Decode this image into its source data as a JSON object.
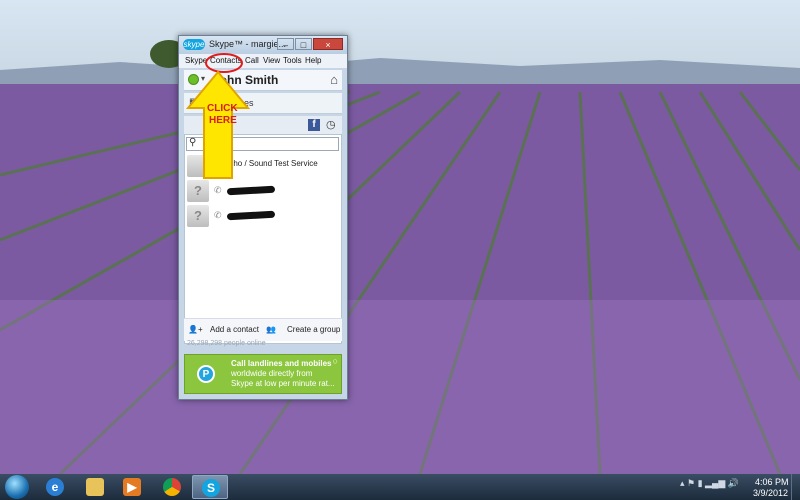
{
  "window": {
    "title": "Skype™ - margie...",
    "logo": "skype",
    "controls": [
      "–",
      "□",
      "×"
    ]
  },
  "menu": [
    "Skype",
    "Contacts",
    "Call",
    "View",
    "Tools",
    "Help"
  ],
  "profile": {
    "name": "John Smith",
    "status_color": "#6cbf2a"
  },
  "call_phones": "Call phones",
  "contacts": [
    {
      "name": "Echo / Sound Test Service",
      "redacted": false
    },
    {
      "name": "",
      "redacted": true
    },
    {
      "name": "",
      "redacted": true
    }
  ],
  "bottom_actions": {
    "add_contact": "Add a contact",
    "create_group": "Create a group"
  },
  "online_count": "26,298,298 people online",
  "promo": {
    "line1": "Call landlines and mobiles",
    "line2_bold": "worldwide",
    "line2": "worldwide directly from",
    "line3": "Skype at low per minute rat..."
  },
  "annotation": {
    "line1": "CLICK",
    "line2": "HERE",
    "color": "#e21a1a",
    "arrow_color": "#ffe600"
  },
  "taskbar": {
    "apps": [
      "internet-explorer-icon",
      "file-explorer-icon",
      "media-player-icon",
      "chrome-icon",
      "skype-icon"
    ],
    "time": "4:06 PM",
    "date": "3/9/2012"
  }
}
